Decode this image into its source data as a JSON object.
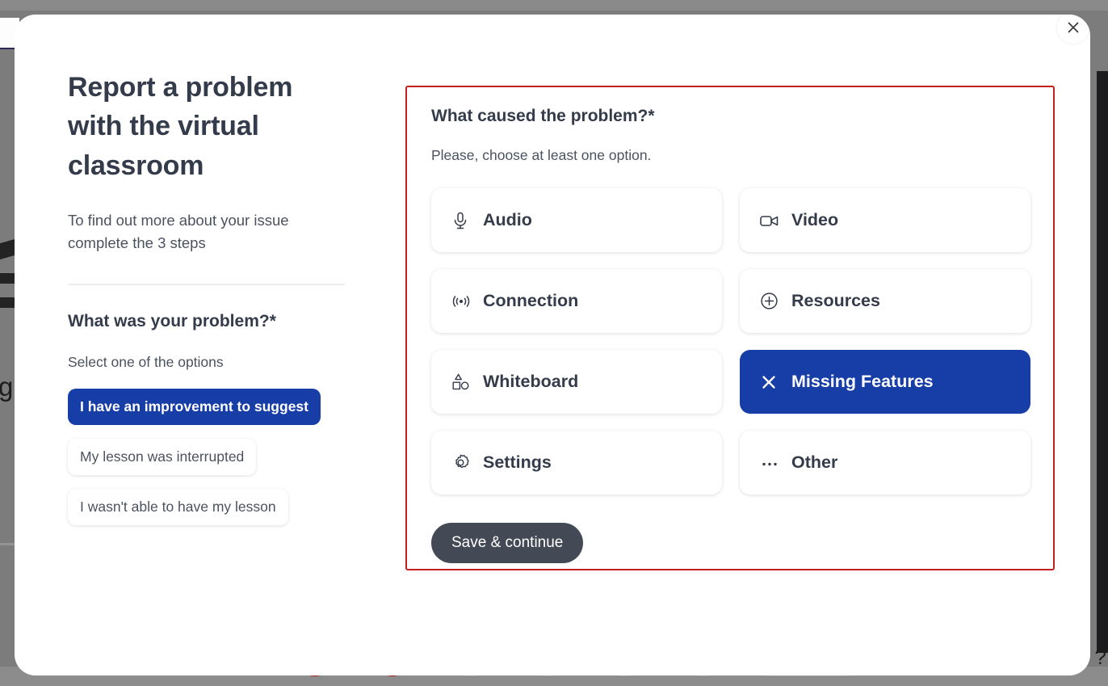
{
  "backdrop": {
    "glyph_left": "g",
    "glyph_right": "?"
  },
  "modal": {
    "close_icon": "close-icon",
    "left": {
      "title": "Report a problem with the virtual classroom",
      "subtitle": "To find out more about your issue complete the 3 steps",
      "question": "What was your problem?*",
      "hint": "Select one of the options",
      "options": [
        {
          "label": "I have an improvement to suggest",
          "selected": true
        },
        {
          "label": "My lesson was interrupted",
          "selected": false
        },
        {
          "label": "I wasn't able to have my lesson",
          "selected": false
        }
      ]
    },
    "right": {
      "question": "What caused the problem?*",
      "hint": "Please, choose at least one option.",
      "cards": [
        {
          "label": "Audio",
          "icon": "microphone-icon",
          "selected": false
        },
        {
          "label": "Video",
          "icon": "video-camera-icon",
          "selected": false
        },
        {
          "label": "Connection",
          "icon": "signal-broadcast-icon",
          "selected": false
        },
        {
          "label": "Resources",
          "icon": "plus-circle-icon",
          "selected": false
        },
        {
          "label": "Whiteboard",
          "icon": "shapes-icon",
          "selected": false
        },
        {
          "label": "Missing Features",
          "icon": "close-x-icon",
          "selected": true
        },
        {
          "label": "Settings",
          "icon": "gear-icon",
          "selected": false
        },
        {
          "label": "Other",
          "icon": "ellipsis-icon",
          "selected": false
        }
      ],
      "save_label": "Save & continue"
    }
  },
  "colors": {
    "accent_blue": "#173da6",
    "annotation_red": "#c2201f",
    "text_dark": "#343b4a",
    "text_muted": "#4b525f",
    "save_button": "#434a55"
  }
}
